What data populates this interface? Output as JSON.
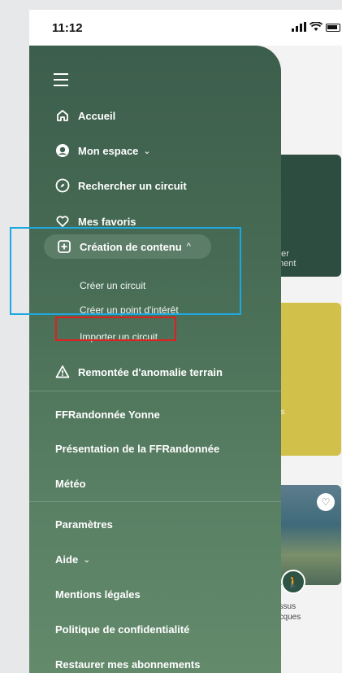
{
  "status": {
    "time": "11:12"
  },
  "menu": {
    "hamburger": "menu",
    "items": [
      {
        "label": "Accueil",
        "icon": "home-icon"
      },
      {
        "label": "Mon espace",
        "icon": "avatar-icon",
        "chevron": "⌄"
      },
      {
        "label": "Rechercher un circuit",
        "icon": "compass-icon"
      },
      {
        "label": "Mes favoris",
        "icon": "heart-icon"
      },
      {
        "label": "Création de contenu",
        "icon": "plus-square-icon",
        "chevron": "^"
      }
    ],
    "subitems": [
      "Créer un circuit",
      "Créer un point d'intérêt",
      "Importer un circuit"
    ],
    "anomaly": {
      "label": "Remontée d'anomalie terrain",
      "icon": "warning-icon"
    },
    "links1": [
      "FFRandonnée Yonne",
      "Présentation de la FFRandonnée",
      "Météo"
    ],
    "links2": [
      "Paramètres",
      "Aide",
      "Mentions légales",
      "Politique de confidentialité",
      "Restaurer mes abonnements"
    ],
    "aide_chevron": "⌄"
  },
  "background": {
    "card1_line1": "ner",
    "card1_line2": "ment",
    "card2_text": "ris",
    "photo_line1": "essus",
    "photo_line2": "acques"
  },
  "colors": {
    "drawer": "#476b54",
    "accent_blue": "#1ea8e0",
    "accent_red": "#e02020"
  }
}
